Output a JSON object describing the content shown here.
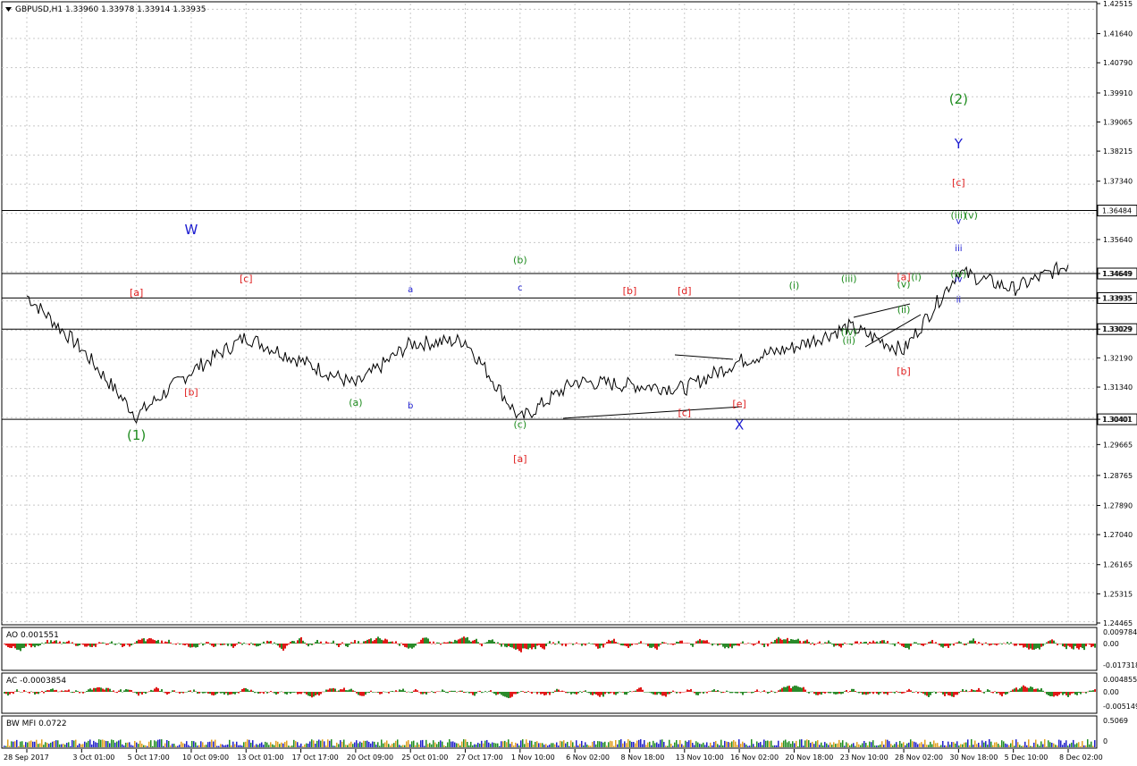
{
  "header": {
    "title": "GBPUSD,H1  1.33960  1.33978  1.33914  1.33935"
  },
  "price_axis": {
    "ticks": [
      "1.42515",
      "1.41640",
      "1.40790",
      "1.39910",
      "1.39065",
      "1.38215",
      "1.37340",
      "1.35640",
      "1.34649",
      "1.33935",
      "1.33029",
      "1.32190",
      "1.31340",
      "1.30401",
      "1.29665",
      "1.28765",
      "1.27890",
      "1.27040",
      "1.26165",
      "1.25315",
      "1.24465"
    ]
  },
  "levels": [
    {
      "price": 1.36484,
      "label": "1.36484"
    },
    {
      "price": 1.34649,
      "label": "1.34649"
    },
    {
      "price": 1.33935,
      "label": "1.33935"
    },
    {
      "price": 1.33029,
      "label": "1.33029"
    },
    {
      "price": 1.30401,
      "label": "1.30401"
    }
  ],
  "time_axis": {
    "labels": [
      "28 Sep 2017",
      "3 Oct 01:00",
      "5 Oct 17:00",
      "10 Oct 09:00",
      "13 Oct 01:00",
      "17 Oct 17:00",
      "20 Oct 09:00",
      "25 Oct 01:00",
      "27 Oct 17:00",
      "1 Nov 10:00",
      "6 Nov 02:00",
      "8 Nov 18:00",
      "13 Nov 10:00",
      "16 Nov 02:00",
      "20 Nov 18:00",
      "23 Nov 10:00",
      "28 Nov 02:00",
      "30 Nov 18:00",
      "5 Dec 10:00",
      "8 Dec 02:00"
    ]
  },
  "indicators": {
    "ao": {
      "label": "AO 0.001551",
      "ticks": [
        "0.009784",
        "0.00",
        "-0.017318"
      ]
    },
    "ac": {
      "label": "AC -0.0003854",
      "ticks": [
        "0.004855",
        "0.00",
        "-0.005149"
      ]
    },
    "mfi": {
      "label": "BW MFI 0.0722",
      "ticks": [
        "0.5069",
        "0"
      ]
    }
  },
  "annotations": [
    {
      "text": "W",
      "color": "#1c1cd0",
      "size": "large",
      "x": "10 Oct 09:00",
      "price": 1.358
    },
    {
      "text": "X",
      "color": "#1c1cd0",
      "size": "large",
      "x": "16 Nov 02:00",
      "price": 1.301
    },
    {
      "text": "Y",
      "color": "#1c1cd0",
      "size": "large",
      "x": "30 Nov 18:00",
      "price": 1.383
    },
    {
      "text": "(1)",
      "color": "#1f8c1f",
      "size": "large",
      "x": "5 Oct 17:00",
      "price": 1.298
    },
    {
      "text": "(2)",
      "color": "#1f8c1f",
      "size": "large",
      "x": "30 Nov 18:00",
      "price": 1.396
    },
    {
      "text": "[a]",
      "color": "#e02020",
      "size": "mid",
      "x": "5 Oct 17:00",
      "price": 1.34
    },
    {
      "text": "[b]",
      "color": "#e02020",
      "size": "mid",
      "x": "10 Oct 09:00",
      "price": 1.311
    },
    {
      "text": "[c]",
      "color": "#e02020",
      "size": "mid",
      "x": "13 Oct 01:00",
      "price": 1.344
    },
    {
      "text": "(a)",
      "color": "#1f8c1f",
      "size": "mid",
      "x": "20 Oct 09:00",
      "price": 1.308
    },
    {
      "text": "a",
      "color": "#1c1cd0",
      "size": "small",
      "x": "25 Oct 01:00",
      "price": 1.341
    },
    {
      "text": "b",
      "color": "#1c1cd0",
      "size": "small",
      "x": "25 Oct 01:00",
      "price": 1.3072
    },
    {
      "text": "c",
      "color": "#1c1cd0",
      "size": "small",
      "x": "1 Nov 10:00",
      "price": 1.3415
    },
    {
      "text": "(b)",
      "color": "#1f8c1f",
      "size": "mid",
      "x": "1 Nov 10:00",
      "price": 1.3495
    },
    {
      "text": "(c)",
      "color": "#1f8c1f",
      "size": "mid",
      "x": "1 Nov 10:00",
      "price": 1.3015
    },
    {
      "text": "[a]",
      "color": "#e02020",
      "size": "mid",
      "x": "1 Nov 10:00",
      "price": 1.2915
    },
    {
      "text": "[b]",
      "color": "#e02020",
      "size": "mid",
      "x": "8 Nov 18:00",
      "price": 1.3405
    },
    {
      "text": "[c]",
      "color": "#e02020",
      "size": "mid",
      "x": "13 Nov 10:00",
      "price": 1.305
    },
    {
      "text": "[d]",
      "color": "#e02020",
      "size": "mid",
      "x": "13 Nov 10:00",
      "price": 1.3405
    },
    {
      "text": "[e]",
      "color": "#e02020",
      "size": "mid",
      "x": "16 Nov 02:00",
      "price": 1.3075
    },
    {
      "text": "(i)",
      "color": "#1f8c1f",
      "size": "mid",
      "x": "20 Nov 18:00",
      "price": 1.342
    },
    {
      "text": "(ii)",
      "color": "#1f8c1f",
      "size": "mid",
      "x": "23 Nov 10:00",
      "price": 1.326
    },
    {
      "text": "(iii)",
      "color": "#1f8c1f",
      "size": "mid",
      "x": "23 Nov 10:00",
      "price": 1.344
    },
    {
      "text": "(iv)",
      "color": "#1f8c1f",
      "size": "mid",
      "x": "23 Nov 10:00",
      "price": 1.3285
    },
    {
      "text": "(v)",
      "color": "#1f8c1f",
      "size": "mid",
      "x": "28 Nov 02:00",
      "price": 1.3425
    },
    {
      "text": "[a]",
      "color": "#e02020",
      "size": "mid",
      "x": "28 Nov 02:00",
      "price": 1.3445
    },
    {
      "text": "[b]",
      "color": "#e02020",
      "size": "mid",
      "x": "28 Nov 02:00",
      "price": 1.317
    },
    {
      "text": "(i)",
      "color": "#1f8c1f",
      "size": "mid",
      "x": "28 Nov 02:00",
      "price": 1.3445
    },
    {
      "text": "(ii)",
      "color": "#1f8c1f",
      "size": "mid",
      "x": "28 Nov 02:00",
      "price": 1.335
    },
    {
      "text": "iii",
      "color": "#1c1cd0",
      "size": "small",
      "x": "30 Nov 18:00",
      "price": 1.353
    },
    {
      "text": "ii",
      "color": "#1c1cd0",
      "size": "small",
      "x": "30 Nov 18:00",
      "price": 1.338
    },
    {
      "text": "iv",
      "color": "#1c1cd0",
      "size": "small",
      "x": "30 Nov 18:00",
      "price": 1.344
    },
    {
      "text": "v",
      "color": "#1c1cd0",
      "size": "small",
      "x": "30 Nov 18:00",
      "price": 1.361
    },
    {
      "text": "(iii)",
      "color": "#1f8c1f",
      "size": "mid",
      "x": "30 Nov 18:00",
      "price": 1.3625
    },
    {
      "text": "(v)",
      "color": "#1f8c1f",
      "size": "mid",
      "x": "30 Nov 18:00",
      "price": 1.3625
    },
    {
      "text": "(iv)",
      "color": "#1f8c1f",
      "size": "mid",
      "x": "30 Nov 18:00",
      "price": 1.3455
    },
    {
      "text": "[c]",
      "color": "#e02020",
      "size": "mid",
      "x": "30 Nov 18:00",
      "price": 1.372
    }
  ],
  "chart_data": {
    "type": "line",
    "symbol": "GBPUSD",
    "timeframe": "H1",
    "ylim": [
      1.24465,
      1.42515
    ],
    "categories": [
      "28 Sep 2017",
      "3 Oct 01:00",
      "5 Oct 17:00",
      "10 Oct 09:00",
      "13 Oct 01:00",
      "17 Oct 17:00",
      "20 Oct 09:00",
      "25 Oct 01:00",
      "27 Oct 17:00",
      "1 Nov 10:00",
      "6 Nov 02:00",
      "8 Nov 18:00",
      "13 Nov 10:00",
      "16 Nov 02:00",
      "20 Nov 18:00",
      "23 Nov 10:00",
      "28 Nov 02:00",
      "30 Nov 18:00",
      "5 Dec 10:00",
      "8 Dec 02:00"
    ],
    "series": [
      {
        "name": "GBPUSD,H1",
        "values": [
          1.34,
          1.3245,
          1.305,
          1.318,
          1.328,
          1.321,
          1.314,
          1.326,
          1.327,
          1.304,
          1.315,
          1.314,
          1.313,
          1.321,
          1.325,
          1.331,
          1.324,
          1.347,
          1.342,
          1.349
        ]
      }
    ],
    "grid": true,
    "legend": "none"
  }
}
